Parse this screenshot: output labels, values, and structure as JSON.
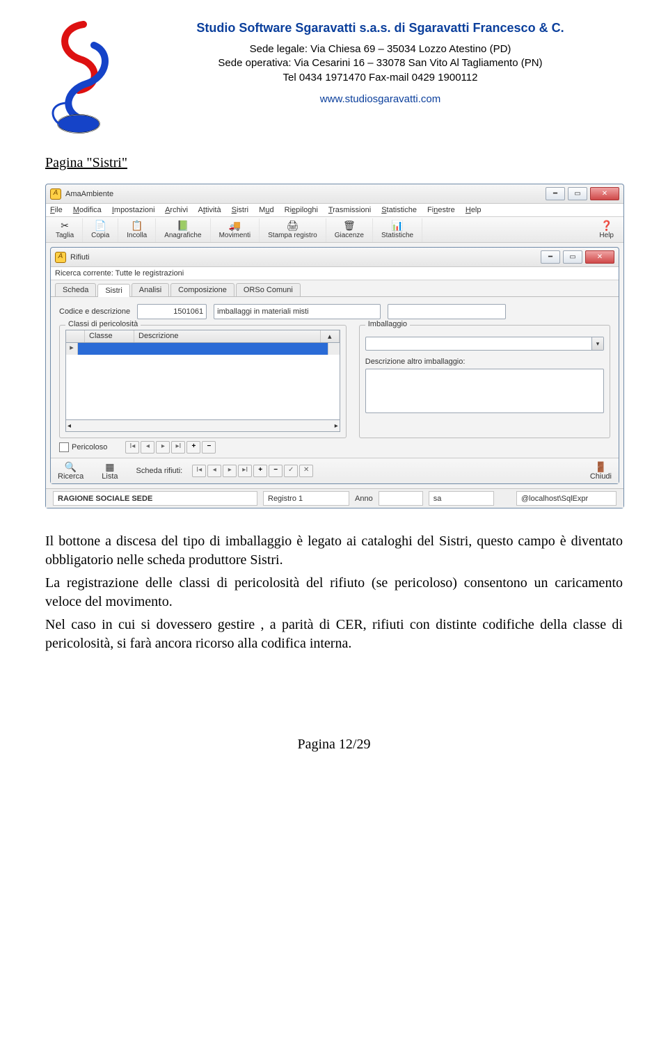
{
  "header": {
    "company": "Studio Software Sgaravatti s.a.s. di Sgaravatti Francesco & C.",
    "addr1": "Sede legale: Via Chiesa 69 – 35034 Lozzo Atestino (PD)",
    "addr2": "Sede operativa: Via Cesarini 16 – 33078 San Vito Al Tagliamento (PN)",
    "tel": "Tel 0434 1971470 Fax-mail 0429 1900112",
    "website": "www.studiosgaravatti.com"
  },
  "section_title": "Pagina \"Sistri\"",
  "app": {
    "title": "AmaAmbiente",
    "menubar": [
      "File",
      "Modifica",
      "Impostazioni",
      "Archivi",
      "Attività",
      "Sistri",
      "Mud",
      "Riepiloghi",
      "Trasmissioni",
      "Statistiche",
      "Finestre",
      "Help"
    ],
    "toolbar": [
      {
        "icon": "✂",
        "label": "Taglia"
      },
      {
        "icon": "📄",
        "label": "Copia"
      },
      {
        "icon": "📋",
        "label": "Incolla"
      },
      {
        "icon": "📗",
        "label": "Anagrafiche"
      },
      {
        "icon": "🚚",
        "label": "Movimenti"
      },
      {
        "icon": "🖨",
        "label": "Stampa registro"
      },
      {
        "icon": "🗑",
        "label": "Giacenze"
      },
      {
        "icon": "📊",
        "label": "Statistiche"
      },
      {
        "icon": "❓",
        "label": "Help"
      }
    ],
    "child": {
      "title": "Rifiuti",
      "search_label": "Ricerca corrente: Tutte le registrazioni",
      "tabs": [
        "Scheda",
        "Sistri",
        "Analisi",
        "Composizione",
        "ORSo Comuni"
      ],
      "active_tab": "Sistri",
      "codice_label": "Codice e descrizione",
      "codice_value": "1501061",
      "desc_value": "imballaggi in materiali misti",
      "classi_legend": "Classi di pericolosità",
      "grid": {
        "cols": [
          "Classe",
          "Descrizione"
        ]
      },
      "imballaggio_legend": "Imballaggio",
      "desc_altro_label": "Descrizione altro imballaggio:",
      "pericoloso_label": "Pericoloso",
      "scheda_rifiuti_label": "Scheda rifiuti:"
    },
    "footer_toolbar": {
      "ricerca": "Ricerca",
      "lista": "Lista",
      "chiudi": "Chiudi"
    },
    "status": {
      "ragione": "RAGIONE SOCIALE SEDE",
      "registro": "Registro 1",
      "anno_lbl": "Anno",
      "anno_val": "",
      "sa": "sa",
      "host": "@localhost\\SqlExpr"
    }
  },
  "body": {
    "p1": "Il bottone a discesa del tipo di imballaggio è legato ai cataloghi del Sistri, questo campo è diventato obbligatorio nelle scheda produttore Sistri.",
    "p2": "La registrazione delle classi di pericolosità del rifiuto (se pericoloso) consentono un caricamento veloce del movimento.",
    "p3": "Nel caso in cui si dovessero gestire , a parità di CER, rifiuti con distinte codifiche della classe di pericolosità, si farà ancora ricorso alla codifica interna."
  },
  "page_number": "Pagina 12/29"
}
